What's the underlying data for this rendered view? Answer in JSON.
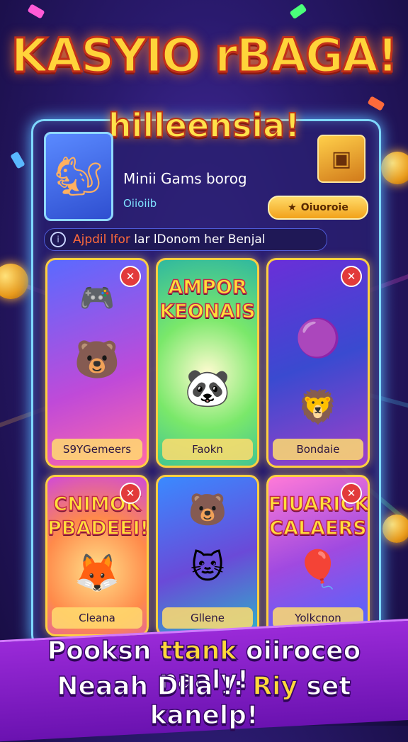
{
  "title": "KASYIO rBAGA!",
  "subtitle": "hilleensia!",
  "header": {
    "title": "Minii Gams borog",
    "subtitle": "Oiioiib",
    "button_label": "Oiuoroie"
  },
  "notice": {
    "prefix": "Ajpdil lfor",
    "text": "lar lDonom her Benjal"
  },
  "cards": [
    {
      "label": "S9YGemeers",
      "headline": ""
    },
    {
      "label": "Faokn",
      "headline": "AMPOR KEONAIS"
    },
    {
      "label": "Bondaie",
      "headline": ""
    },
    {
      "label": "Cleana",
      "headline": "CNIMOK PBADEEI!"
    },
    {
      "label": "Gllene",
      "headline": ""
    },
    {
      "label": "Yolkcnon",
      "headline": "FIUARICK CALAERS"
    }
  ],
  "banner": {
    "line1_a": "Pooksn",
    "line1_b": "ttank",
    "line1_c": "oiiroceo naaly!",
    "line2_a": "Neaah Dlla !:",
    "line2_b": "Riy",
    "line2_c": "set kanelp!"
  },
  "colors": {
    "background": "#2a1a6e",
    "frame_border": "#7fd8ff",
    "title_yellow": "#ffd43a",
    "close_red": "#e23a3a",
    "banner_purple": "#9a2ad8"
  },
  "icons": {
    "chest": "treasure-chest-icon",
    "star": "star-icon",
    "info": "info-icon",
    "close": "close-icon"
  }
}
